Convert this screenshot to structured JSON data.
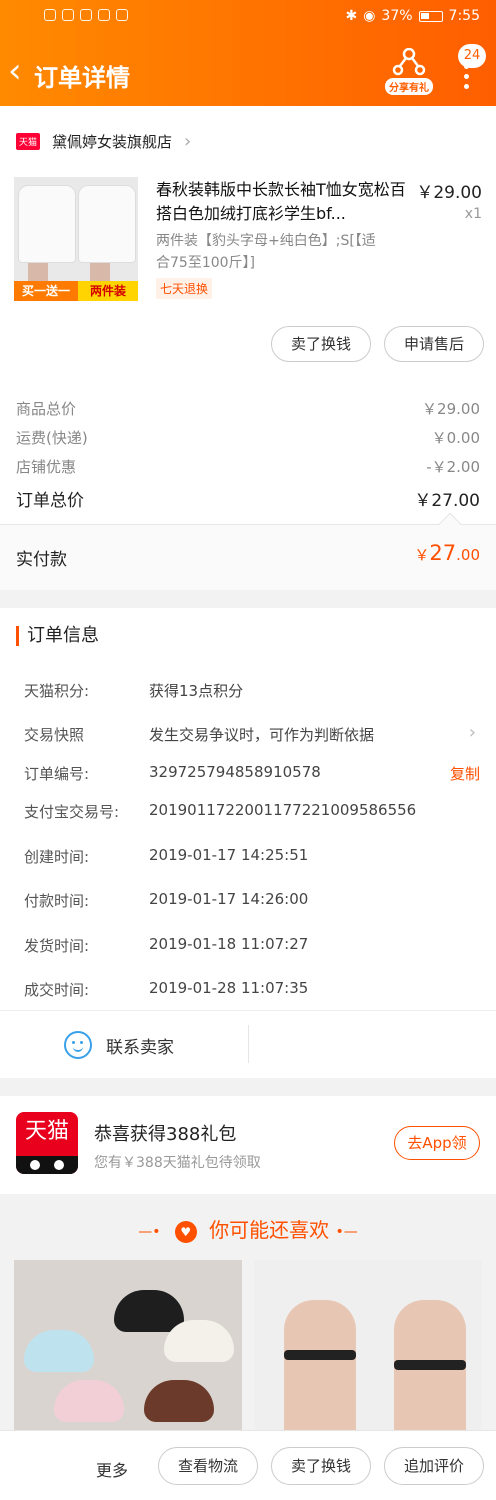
{
  "status_bar": {
    "battery": "37%",
    "time": "7:55"
  },
  "header": {
    "title": "订单详情",
    "share_label": "分享有礼",
    "badge_count": "24"
  },
  "store": {
    "badge": "天猫",
    "name": "黛佩婷女装旗舰店"
  },
  "product": {
    "title": "春秋装韩版中长款长袖T恤女宽松百搭白色加绒打底衫学生bf...",
    "price": "￥29.00",
    "qty": "x1",
    "sku": "两件装【豹头字母+纯白色】;S[【适合75至100斤】]",
    "return_tag": "七天退换",
    "promo_left": "买一送一",
    "promo_right": "两件装"
  },
  "actions": {
    "resell": "卖了换钱",
    "after_sale": "申请售后"
  },
  "fees": [
    {
      "label": "商品总价",
      "value": "￥29.00"
    },
    {
      "label": "运费(快递)",
      "value": "￥0.00"
    },
    {
      "label": "店铺优惠",
      "value": "-￥2.00"
    }
  ],
  "order_total": {
    "label": "订单总价",
    "value": "￥27.00"
  },
  "paid": {
    "label": "实付款",
    "currency": "￥",
    "int": "27",
    "dec": ".00"
  },
  "order_info": {
    "title": "订单信息",
    "rows": [
      {
        "label": "天猫积分:",
        "value": "获得13点积分"
      },
      {
        "label": "交易快照",
        "value": "发生交易争议时，可作为判断依据"
      },
      {
        "label": "订单编号:",
        "value": "329725794858910578"
      },
      {
        "label": "支付宝交易号:",
        "value": "2019011722001177221009586556"
      },
      {
        "label": "创建时间:",
        "value": "2019-01-17 14:25:51"
      },
      {
        "label": "付款时间:",
        "value": "2019-01-17 14:26:00"
      },
      {
        "label": "发货时间:",
        "value": "2019-01-18 11:07:27"
      },
      {
        "label": "成交时间:",
        "value": "2019-01-28 11:07:35"
      }
    ],
    "copy_label": "复制",
    "contact_label": "联系卖家"
  },
  "gift": {
    "logo_text": "天猫",
    "title": "恭喜获得388礼包",
    "subtitle": "您有￥388天猫礼包待领取",
    "button": "去App领"
  },
  "recommend": {
    "title": "你可能还喜欢"
  },
  "bottom_bar": {
    "more": "更多",
    "logistics": "查看物流",
    "resell": "卖了换钱",
    "review": "追加评价"
  },
  "colors": {
    "accent": "#ff5000",
    "header_start": "#ff8a00",
    "header_end": "#ff5e00"
  }
}
